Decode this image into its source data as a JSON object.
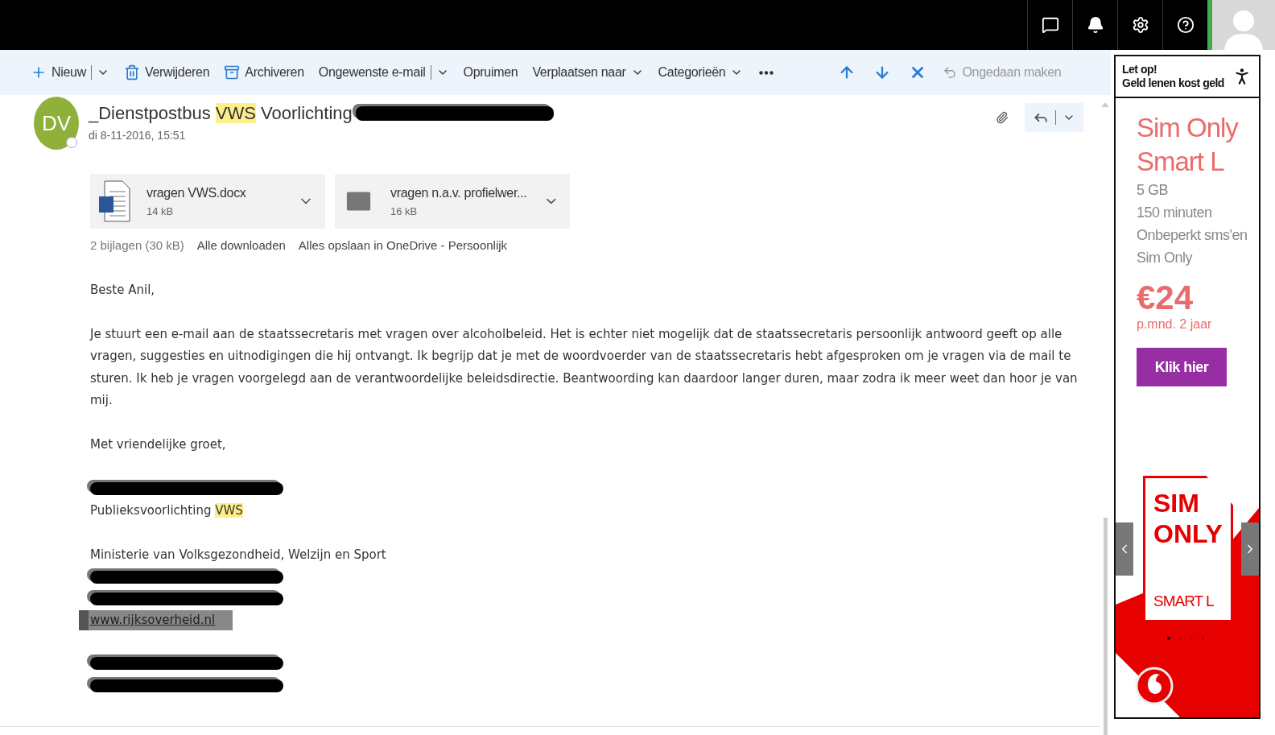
{
  "topbar": {
    "icons": [
      {
        "kind": "chat"
      },
      {
        "kind": "bell"
      },
      {
        "kind": "settings"
      },
      {
        "kind": "help"
      }
    ]
  },
  "toolbar": {
    "items": [
      {
        "kind": "new",
        "label": "Nieuw"
      },
      {
        "kind": "delete",
        "label": "Verwijderen"
      },
      {
        "kind": "archive",
        "label": "Archiveren"
      },
      {
        "kind": "junk",
        "label": "Ongewenste e-mail"
      },
      {
        "kind": "sweep",
        "label": "Opruimen"
      },
      {
        "kind": "dropdown",
        "label": "Verplaatsen naar"
      },
      {
        "kind": "dropdown",
        "label": "Categorieën"
      },
      {
        "kind": "more"
      },
      {
        "kind": "up"
      },
      {
        "kind": "down"
      },
      {
        "kind": "close"
      },
      {
        "kind": "undo",
        "label": "Ongedaan maken",
        "disabled": true
      }
    ]
  },
  "message": {
    "avatar": "DV",
    "sender": [
      {
        "text": "_Dienstpostbus ",
        "highlighted": false
      },
      {
        "text": "VWS",
        "highlighted": true
      },
      {
        "text": " Voorlichting",
        "highlighted": false
      }
    ],
    "date": "di 8-11-2016, 15:51",
    "attachments": [
      {
        "kind": "word",
        "name": "vragen VWS.docx",
        "size": "14 kB"
      },
      {
        "kind": "mail",
        "name": "vragen n.a.v. profielwer...",
        "size": "16 kB"
      }
    ],
    "attachment_summary": "2 bijlagen (30 kB)",
    "attachment_links": [
      "Alle downloaden",
      "Alles opslaan in OneDrive - Persoonlijk"
    ],
    "body": [
      {
        "kind": "text",
        "parts": [
          {
            "text": "Beste Anil,",
            "highlighted": false
          }
        ]
      },
      {
        "kind": "text",
        "parts": [
          {
            "text": "Je stuurt een e-mail aan de staatssecretaris met vragen over alcoholbeleid. Het is echter niet mogelijk dat de staatssecretaris persoonlijk antwoord geeft op alle vragen, suggesties en uitnodigingen die hij ontvangt. Ik begrijp dat je met de woordvoerder van de staatssecretaris hebt afgesproken om je vragen via de mail te sturen. Ik heb je vragen voorgelegd aan de verantwoordelijke beleidsdirectie. Beantwoording kan daardoor langer duren, maar zodra ik meer weet dan hoor je van mij.",
            "highlighted": false
          }
        ]
      },
      {
        "kind": "text",
        "parts": [
          {
            "text": "Met vriendelijke groet,",
            "highlighted": false
          }
        ]
      },
      {
        "kind": "redacted"
      },
      {
        "kind": "line",
        "parts": [
          {
            "text": "Publieksvoorlichting ",
            "highlighted": false
          },
          {
            "text": "VWS",
            "highlighted": true
          }
        ]
      },
      {
        "kind": "gap"
      },
      {
        "kind": "line",
        "parts": [
          {
            "text": "Ministerie van Volksgezondheid, Welzijn en Sport",
            "highlighted": false
          }
        ]
      },
      {
        "kind": "redacted"
      },
      {
        "kind": "redacted"
      },
      {
        "kind": "link",
        "text": "www.rijksoverheid.nl"
      },
      {
        "kind": "gap"
      },
      {
        "kind": "redacted"
      },
      {
        "kind": "redacted"
      }
    ]
  },
  "ad": {
    "notice": [
      "Let op!",
      "Geld lenen kost geld"
    ],
    "title": [
      "Sim Only",
      "Smart L"
    ],
    "features": [
      "5 GB",
      "150 minuten",
      "Onbeperkt sms'en",
      "Sim Only"
    ],
    "price": "€24",
    "price_note": "p.mnd. 2 jaar",
    "button": "Klik hier",
    "card": [
      "SIM",
      "ONLY",
      "SMART L"
    ],
    "dots": [
      {
        "selected": true
      },
      {
        "selected": false
      },
      {
        "selected": false
      },
      {
        "selected": false
      }
    ]
  }
}
